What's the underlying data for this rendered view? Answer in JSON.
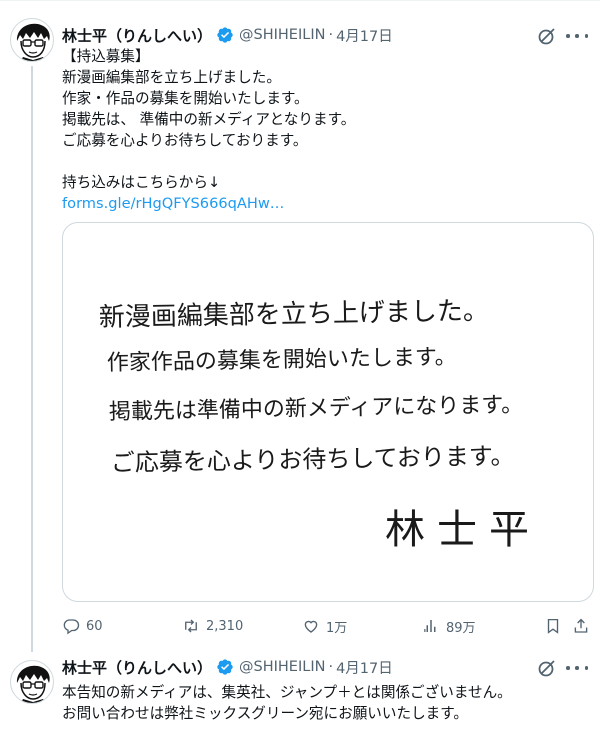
{
  "tweets": [
    {
      "author": {
        "name": "林士平（りんしへい）",
        "handle": "@SHIHEILIN",
        "date": "4月17日"
      },
      "text_lines": [
        "【持込募集】",
        "新漫画編集部を立ち上げました。",
        "作家・作品の募集を開始いたします。",
        "掲載先は、 準備中の新メディアとなります。",
        "ご応募を心よりお待ちしております。",
        "",
        "持ち込みはこちらから↓"
      ],
      "link": "forms.gle/rHgQFYS666qAHw…",
      "image_text": {
        "lines": [
          "新漫画編集部を立ち上げました。",
          "作家作品の募集を開始いたします。",
          "掲載先は準備中の新メディアになります。",
          "ご応募を心よりお待ちしております。"
        ],
        "signature": "林士平"
      },
      "metrics": {
        "replies": "60",
        "retweets": "2,310",
        "likes": "1万",
        "views": "89万"
      }
    },
    {
      "author": {
        "name": "林士平（りんしへい）",
        "handle": "@SHIHEILIN",
        "date": "4月17日"
      },
      "text_lines": [
        "本告知の新メディアは、集英社、ジャンプ＋とは関係ございません。",
        "お問い合わせは弊社ミックスグリーン宛にお願いいたします。"
      ]
    }
  ],
  "colors": {
    "text": "#0f1419",
    "secondary": "#536471",
    "link": "#1d9bf0",
    "verified": "#1d9bf0",
    "border": "#cfd9de"
  },
  "icons": [
    "verified-badge-icon",
    "grok-icon",
    "more-icon",
    "reply-icon",
    "retweet-icon",
    "like-icon",
    "views-icon",
    "bookmark-icon",
    "share-icon"
  ]
}
